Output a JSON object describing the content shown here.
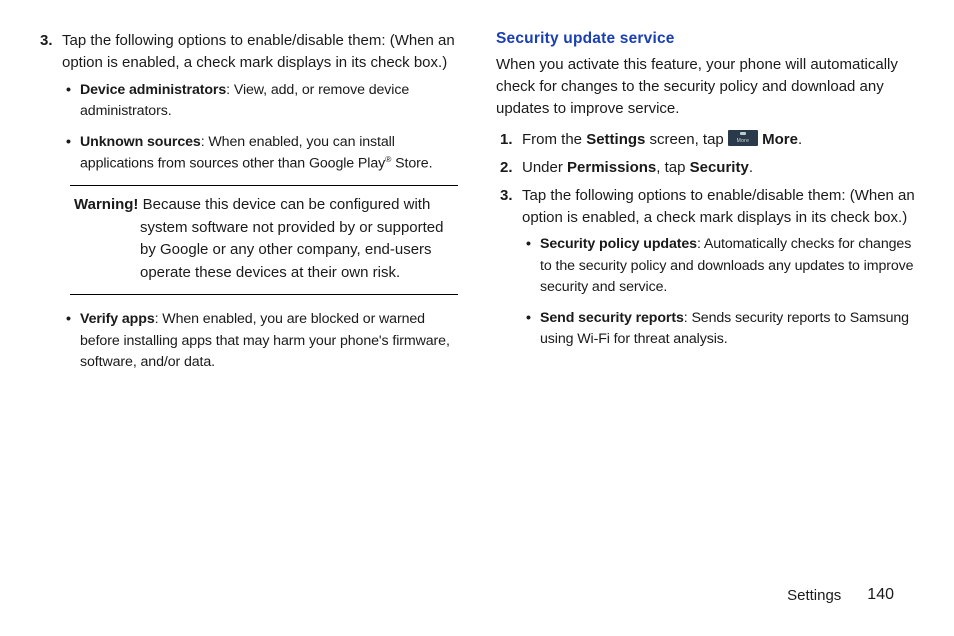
{
  "left": {
    "step3_num": "3.",
    "step3_text": "Tap the following options to enable/disable them: (When an option is enabled, a check mark displays in its check box.)",
    "bullets": [
      {
        "label": "Device administrators",
        "desc": ": View, add, or remove device administrators."
      },
      {
        "label": "Unknown sources",
        "desc": ": When enabled, you can install applications from sources other than Google Play",
        "trail": " Store.",
        "sup": "®"
      }
    ],
    "warning_label": "Warning! ",
    "warning_text": "Because this device can be configured with system software not provided by or supported by Google or any other company, end-users operate these devices at their own risk.",
    "verify_label": "Verify apps",
    "verify_desc": ": When enabled, you are blocked or warned before installing apps that may harm your phone's firmware, software, and/or data."
  },
  "right": {
    "heading": "Security update service",
    "intro": "When you activate this feature, your phone will automatically check for changes to the security policy and download any updates to improve service.",
    "step1_num": "1.",
    "step1_a": "From the ",
    "step1_b": "Settings",
    "step1_c": " screen, tap ",
    "step1_d": " More",
    "step1_e": ".",
    "step2_num": "2.",
    "step2_a": "Under ",
    "step2_b": "Permissions",
    "step2_c": ", tap ",
    "step2_d": "Security",
    "step2_e": ".",
    "step3_num": "3.",
    "step3_text": "Tap the following options to enable/disable them: (When an option is enabled, a check mark displays in its check box.)",
    "bullets": [
      {
        "label": "Security policy updates",
        "desc": ": Automatically checks for changes to the security policy and downloads any updates to improve security and service."
      },
      {
        "label": "Send security reports",
        "desc": ": Sends security reports to Samsung using Wi-Fi for threat analysis."
      }
    ]
  },
  "footer": {
    "section": "Settings",
    "page": "140"
  }
}
